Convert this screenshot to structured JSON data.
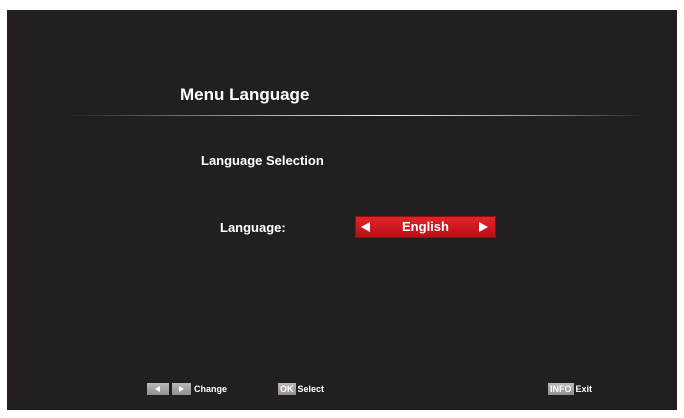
{
  "menu": {
    "title": "Menu Language",
    "section_title": "Language Selection",
    "language_label": "Language:",
    "language_value": "English"
  },
  "footer": {
    "change_label": "Change",
    "ok_key": "OK",
    "select_label": "Select",
    "info_key": "INFO",
    "exit_label": "Exit"
  },
  "colors": {
    "background": "#231f20",
    "selector_red": "#e3262a",
    "text": "#ffffff",
    "key_gray": "#a5a5a5"
  },
  "icons": {
    "selector_left": "arrow-left-icon",
    "selector_right": "arrow-right-icon",
    "footer_left": "remote-left-key-icon",
    "footer_right": "remote-right-key-icon"
  }
}
